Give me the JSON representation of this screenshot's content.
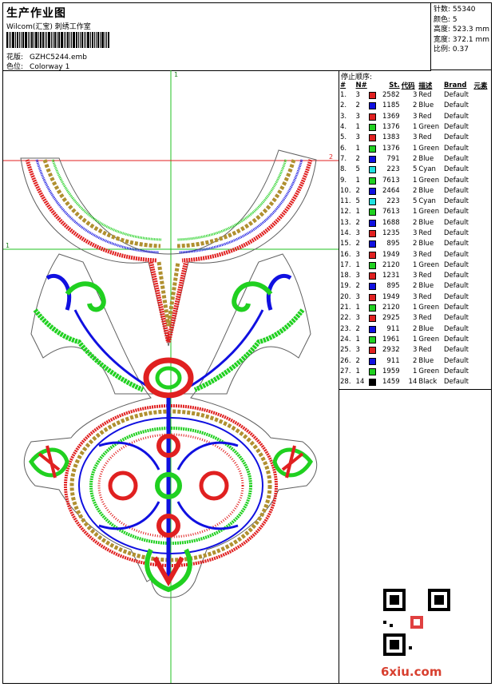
{
  "header": {
    "title": "生产作业图",
    "company": "Wilcom(汇宝) 刺绣工作室",
    "file_label": "花版:",
    "file_value": "GZHC5244.emb",
    "colorway_label": "色位:",
    "colorway_value": "Colorway 1"
  },
  "stats": {
    "stitches": "针数: 55340",
    "colors": "颜色: 5",
    "height": "高度: 523.3 mm",
    "width": "宽度: 372.1 mm",
    "scale": "比例: 0.37"
  },
  "guides": {
    "v_label": "1",
    "h1_label": "1",
    "h2_label": "2"
  },
  "sequence": {
    "title": "停止顺序:",
    "columns": [
      "#",
      "N#",
      "St.",
      "代码",
      "描述",
      "Brand",
      "元素"
    ],
    "rows": [
      {
        "i": "1.",
        "n": "3",
        "c": "#e02020",
        "st": "2582",
        "code": "3",
        "desc": "Red",
        "brand": "Default"
      },
      {
        "i": "2.",
        "n": "2",
        "c": "#1010e0",
        "st": "1185",
        "code": "2",
        "desc": "Blue",
        "brand": "Default"
      },
      {
        "i": "3.",
        "n": "3",
        "c": "#e02020",
        "st": "1369",
        "code": "3",
        "desc": "Red",
        "brand": "Default"
      },
      {
        "i": "4.",
        "n": "1",
        "c": "#20d020",
        "st": "1376",
        "code": "1",
        "desc": "Green",
        "brand": "Default"
      },
      {
        "i": "5.",
        "n": "3",
        "c": "#e02020",
        "st": "1383",
        "code": "3",
        "desc": "Red",
        "brand": "Default"
      },
      {
        "i": "6.",
        "n": "1",
        "c": "#20d020",
        "st": "1376",
        "code": "1",
        "desc": "Green",
        "brand": "Default"
      },
      {
        "i": "7.",
        "n": "2",
        "c": "#1010e0",
        "st": "791",
        "code": "2",
        "desc": "Blue",
        "brand": "Default"
      },
      {
        "i": "8.",
        "n": "5",
        "c": "#20e0e0",
        "st": "223",
        "code": "5",
        "desc": "Cyan",
        "brand": "Default"
      },
      {
        "i": "9.",
        "n": "1",
        "c": "#20d020",
        "st": "7613",
        "code": "1",
        "desc": "Green",
        "brand": "Default"
      },
      {
        "i": "10.",
        "n": "2",
        "c": "#1010e0",
        "st": "2464",
        "code": "2",
        "desc": "Blue",
        "brand": "Default"
      },
      {
        "i": "11.",
        "n": "5",
        "c": "#20e0e0",
        "st": "223",
        "code": "5",
        "desc": "Cyan",
        "brand": "Default"
      },
      {
        "i": "12.",
        "n": "1",
        "c": "#20d020",
        "st": "7613",
        "code": "1",
        "desc": "Green",
        "brand": "Default"
      },
      {
        "i": "13.",
        "n": "2",
        "c": "#1010e0",
        "st": "1688",
        "code": "2",
        "desc": "Blue",
        "brand": "Default"
      },
      {
        "i": "14.",
        "n": "3",
        "c": "#e02020",
        "st": "1235",
        "code": "3",
        "desc": "Red",
        "brand": "Default"
      },
      {
        "i": "15.",
        "n": "2",
        "c": "#1010e0",
        "st": "895",
        "code": "2",
        "desc": "Blue",
        "brand": "Default"
      },
      {
        "i": "16.",
        "n": "3",
        "c": "#e02020",
        "st": "1949",
        "code": "3",
        "desc": "Red",
        "brand": "Default"
      },
      {
        "i": "17.",
        "n": "1",
        "c": "#20d020",
        "st": "2120",
        "code": "1",
        "desc": "Green",
        "brand": "Default"
      },
      {
        "i": "18.",
        "n": "3",
        "c": "#e02020",
        "st": "1231",
        "code": "3",
        "desc": "Red",
        "brand": "Default"
      },
      {
        "i": "19.",
        "n": "2",
        "c": "#1010e0",
        "st": "895",
        "code": "2",
        "desc": "Blue",
        "brand": "Default"
      },
      {
        "i": "20.",
        "n": "3",
        "c": "#e02020",
        "st": "1949",
        "code": "3",
        "desc": "Red",
        "brand": "Default"
      },
      {
        "i": "21.",
        "n": "1",
        "c": "#20d020",
        "st": "2120",
        "code": "1",
        "desc": "Green",
        "brand": "Default"
      },
      {
        "i": "22.",
        "n": "3",
        "c": "#e02020",
        "st": "2925",
        "code": "3",
        "desc": "Red",
        "brand": "Default"
      },
      {
        "i": "23.",
        "n": "2",
        "c": "#1010e0",
        "st": "911",
        "code": "2",
        "desc": "Blue",
        "brand": "Default"
      },
      {
        "i": "24.",
        "n": "1",
        "c": "#20d020",
        "st": "1961",
        "code": "1",
        "desc": "Green",
        "brand": "Default"
      },
      {
        "i": "25.",
        "n": "3",
        "c": "#e02020",
        "st": "2932",
        "code": "3",
        "desc": "Red",
        "brand": "Default"
      },
      {
        "i": "26.",
        "n": "2",
        "c": "#1010e0",
        "st": "911",
        "code": "2",
        "desc": "Blue",
        "brand": "Default"
      },
      {
        "i": "27.",
        "n": "1",
        "c": "#20d020",
        "st": "1959",
        "code": "1",
        "desc": "Green",
        "brand": "Default"
      },
      {
        "i": "28.",
        "n": "14",
        "c": "#000000",
        "st": "1459",
        "code": "14",
        "desc": "Black",
        "brand": "Default"
      }
    ]
  },
  "thread_colors": {
    "red": "#e02020",
    "blue": "#1010e0",
    "green": "#20d020",
    "cyan": "#20e0e0",
    "gold": "#b09030"
  },
  "watermark": "6xiu.com"
}
